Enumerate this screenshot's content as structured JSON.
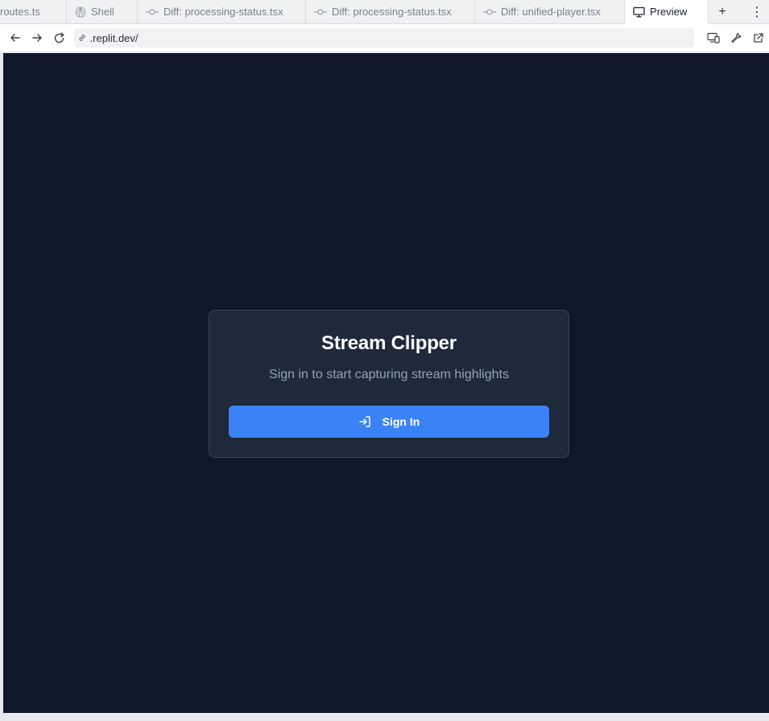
{
  "tabs": [
    {
      "label": "routes.ts",
      "icon": "none",
      "active": false
    },
    {
      "label": "Shell",
      "icon": "shell-icon",
      "active": false
    },
    {
      "label": "Diff: processing-status.tsx",
      "icon": "git-commit-icon",
      "active": false
    },
    {
      "label": "Diff: processing-status.tsx",
      "icon": "git-commit-icon",
      "active": false
    },
    {
      "label": "Diff: unified-player.tsx",
      "icon": "git-commit-icon",
      "active": false
    },
    {
      "label": "Preview",
      "icon": "monitor-icon",
      "active": true
    }
  ],
  "tab_actions": {
    "add": "+",
    "more": "⋮"
  },
  "address": {
    "url": ".replit.dev/"
  },
  "app": {
    "title": "Stream Clipper",
    "subtitle": "Sign in to start capturing stream highlights",
    "signin_label": "Sign In"
  },
  "colors": {
    "background": "#0f172a",
    "card": "#1e293b",
    "button": "#3b82f6",
    "subtitle": "#94a3b8"
  }
}
